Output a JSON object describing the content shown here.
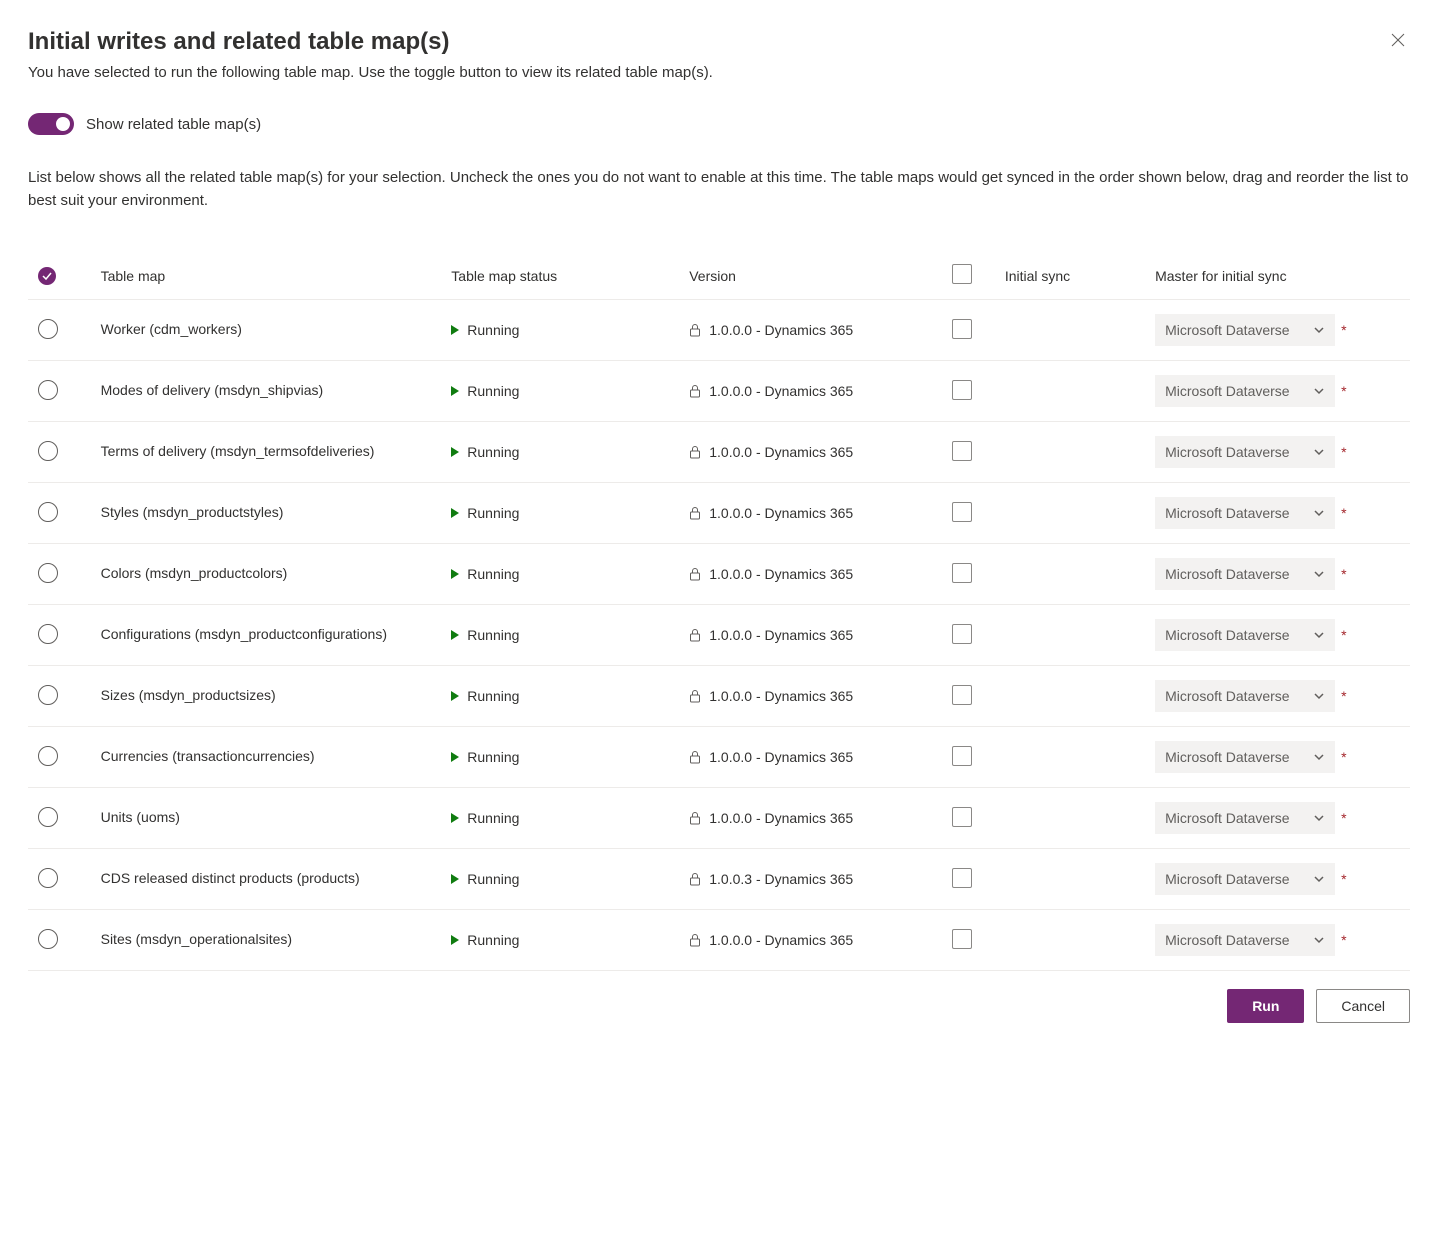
{
  "title": "Initial writes and related table map(s)",
  "subtitle": "You have selected to run the following table map. Use the toggle button to view its related table map(s).",
  "toggle_label": "Show related table map(s)",
  "description": "List below shows all the related table map(s) for your selection. Uncheck the ones you do not want to enable at this time. The table maps would get synced in the order shown below, drag and reorder the list to best suit your environment.",
  "columns": {
    "tablemap": "Table map",
    "status": "Table map status",
    "version": "Version",
    "initialsync": "Initial sync",
    "master": "Master for initial sync"
  },
  "rows": [
    {
      "name": "Worker (cdm_workers)",
      "status": "Running",
      "version": "1.0.0.0 - Dynamics 365",
      "master": "Microsoft Dataverse"
    },
    {
      "name": "Modes of delivery (msdyn_shipvias)",
      "status": "Running",
      "version": "1.0.0.0 - Dynamics 365",
      "master": "Microsoft Dataverse"
    },
    {
      "name": "Terms of delivery (msdyn_termsofdeliveries)",
      "status": "Running",
      "version": "1.0.0.0 - Dynamics 365",
      "master": "Microsoft Dataverse"
    },
    {
      "name": "Styles (msdyn_productstyles)",
      "status": "Running",
      "version": "1.0.0.0 - Dynamics 365",
      "master": "Microsoft Dataverse"
    },
    {
      "name": "Colors (msdyn_productcolors)",
      "status": "Running",
      "version": "1.0.0.0 - Dynamics 365",
      "master": "Microsoft Dataverse"
    },
    {
      "name": "Configurations (msdyn_productconfigurations)",
      "status": "Running",
      "version": "1.0.0.0 - Dynamics 365",
      "master": "Microsoft Dataverse"
    },
    {
      "name": "Sizes (msdyn_productsizes)",
      "status": "Running",
      "version": "1.0.0.0 - Dynamics 365",
      "master": "Microsoft Dataverse"
    },
    {
      "name": "Currencies (transactioncurrencies)",
      "status": "Running",
      "version": "1.0.0.0 - Dynamics 365",
      "master": "Microsoft Dataverse"
    },
    {
      "name": "Units (uoms)",
      "status": "Running",
      "version": "1.0.0.0 - Dynamics 365",
      "master": "Microsoft Dataverse"
    },
    {
      "name": "CDS released distinct products (products)",
      "status": "Running",
      "version": "1.0.0.3 - Dynamics 365",
      "master": "Microsoft Dataverse"
    },
    {
      "name": "Sites (msdyn_operationalsites)",
      "status": "Running",
      "version": "1.0.0.0 - Dynamics 365",
      "master": "Microsoft Dataverse"
    }
  ],
  "buttons": {
    "run": "Run",
    "cancel": "Cancel"
  }
}
